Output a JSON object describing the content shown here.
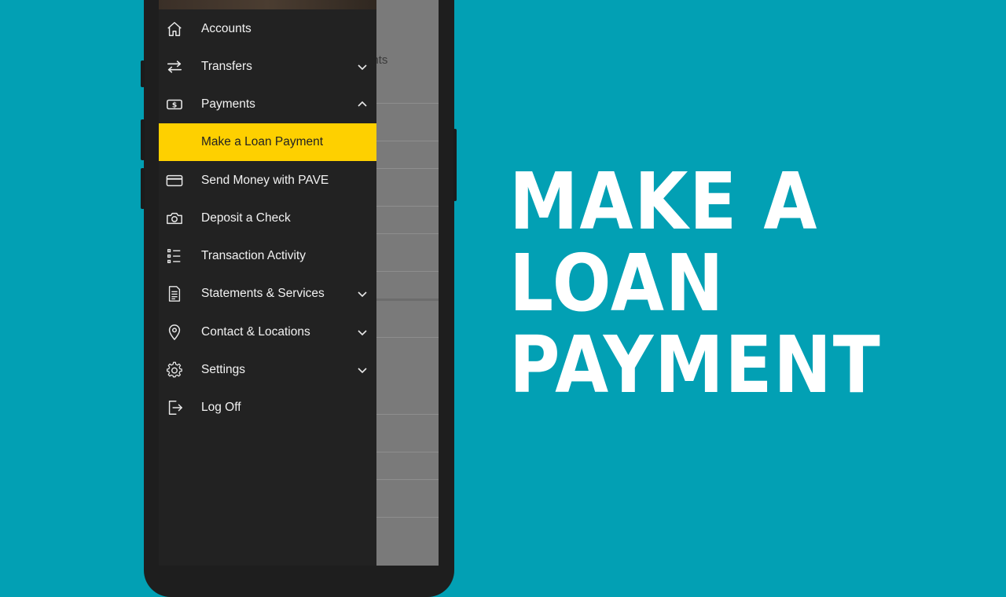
{
  "background_color": "#02A0B4",
  "accent_color": "#FED000",
  "screen": {
    "partial_text": "ents"
  },
  "menu": {
    "items": [
      {
        "label": "Accounts",
        "icon": "home-icon",
        "chevron": "none"
      },
      {
        "label": "Transfers",
        "icon": "transfer-arrows-icon",
        "chevron": "down"
      },
      {
        "label": "Payments",
        "icon": "dollar-bill-icon",
        "chevron": "up"
      },
      {
        "label": "Make a Loan Payment",
        "icon": "",
        "chevron": "none",
        "active": true
      },
      {
        "label": "Send Money with PAVE",
        "icon": "credit-card-icon",
        "chevron": "none"
      },
      {
        "label": "Deposit a Check",
        "icon": "camera-icon",
        "chevron": "none"
      },
      {
        "label": "Transaction Activity",
        "icon": "list-icon",
        "chevron": "none"
      },
      {
        "label": "Statements & Services",
        "icon": "document-icon",
        "chevron": "down"
      },
      {
        "label": "Contact & Locations",
        "icon": "location-pin-icon",
        "chevron": "down"
      },
      {
        "label": "Settings",
        "icon": "gear-icon",
        "chevron": "down"
      },
      {
        "label": "Log Off",
        "icon": "logout-icon",
        "chevron": "none"
      }
    ]
  },
  "headline": {
    "line1": "MAKE A",
    "line2": "LOAN",
    "line3": "PAYMENT"
  }
}
